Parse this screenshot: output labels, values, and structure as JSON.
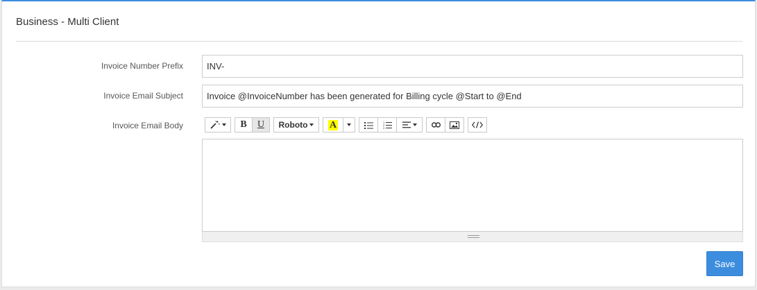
{
  "panel": {
    "title": "Business - Multi Client"
  },
  "form": {
    "prefix_label": "Invoice Number Prefix",
    "prefix_value": "INV-",
    "subject_label": "Invoice Email Subject",
    "subject_value": "Invoice @InvoiceNumber has been generated for Billing cycle @Start to @End",
    "body_label": "Invoice Email Body",
    "body_value": ""
  },
  "toolbar": {
    "bold": "B",
    "underline": "U",
    "font_name": "Roboto",
    "color_letter": "A",
    "highlight_color": "#ffff00"
  },
  "actions": {
    "save_label": "Save"
  },
  "colors": {
    "accent": "#3c8dde"
  }
}
